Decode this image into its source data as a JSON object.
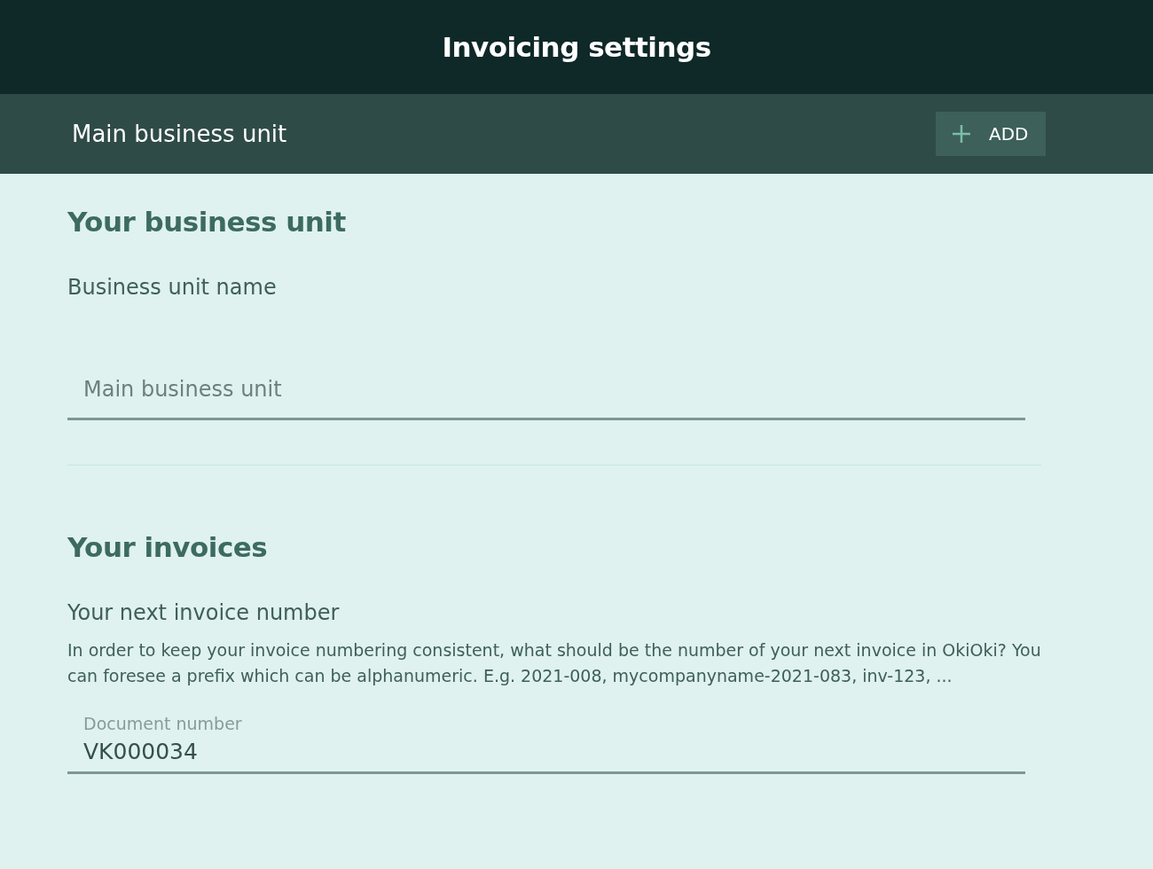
{
  "header": {
    "title": "Invoicing settings"
  },
  "unit_bar": {
    "name": "Main business unit",
    "add_button": {
      "label": "ADD"
    }
  },
  "business_unit": {
    "heading": "Your business unit",
    "field_label": "Business unit name",
    "field": {
      "placeholder": "Main business unit"
    }
  },
  "invoices": {
    "heading": "Your invoices",
    "subheading": "Your next invoice number",
    "description": "In order to keep your invoice numbering consistent, what should be the number of your next invoice in OkiOki? You can foresee a prefix which can be alphanumeric. E.g. 2021-008, mycompanyname-2021-083, inv-123, ...",
    "field": {
      "label": "Document number",
      "value": "VK000034"
    }
  }
}
